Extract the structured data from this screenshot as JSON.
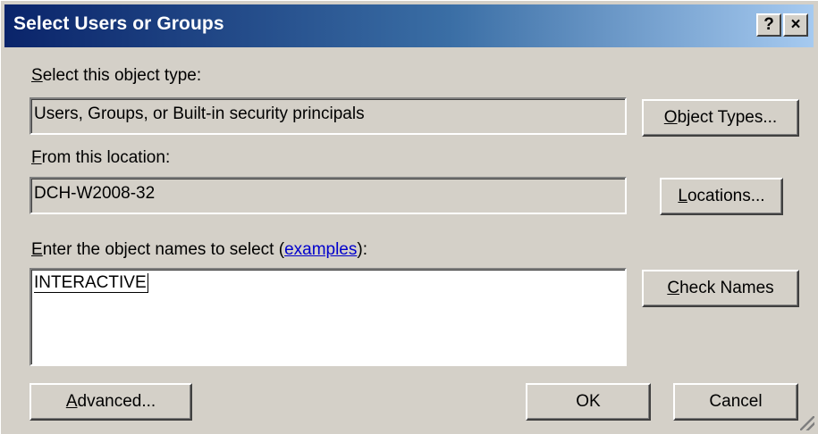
{
  "window": {
    "title": "Select Users or Groups"
  },
  "titlebar": {
    "help_label": "?",
    "close_label": "×"
  },
  "object_type": {
    "label_accel": "S",
    "label_rest": "elect this object type:",
    "value": "Users, Groups, or Built-in security principals",
    "button_accel": "O",
    "button_rest": "bject Types..."
  },
  "location": {
    "label_accel": "F",
    "label_rest": "rom this location:",
    "value": "DCH-W2008-32",
    "button_accel": "L",
    "button_rest": "ocations..."
  },
  "names": {
    "label_accel": "E",
    "label_rest": "nter the object names to select (",
    "link": "examples",
    "label_end": "):",
    "value": "INTERACTIVE",
    "check_accel": "C",
    "check_rest": "heck Names"
  },
  "footer": {
    "advanced_accel": "A",
    "advanced_rest": "dvanced...",
    "ok_label": "OK",
    "cancel_label": "Cancel"
  }
}
